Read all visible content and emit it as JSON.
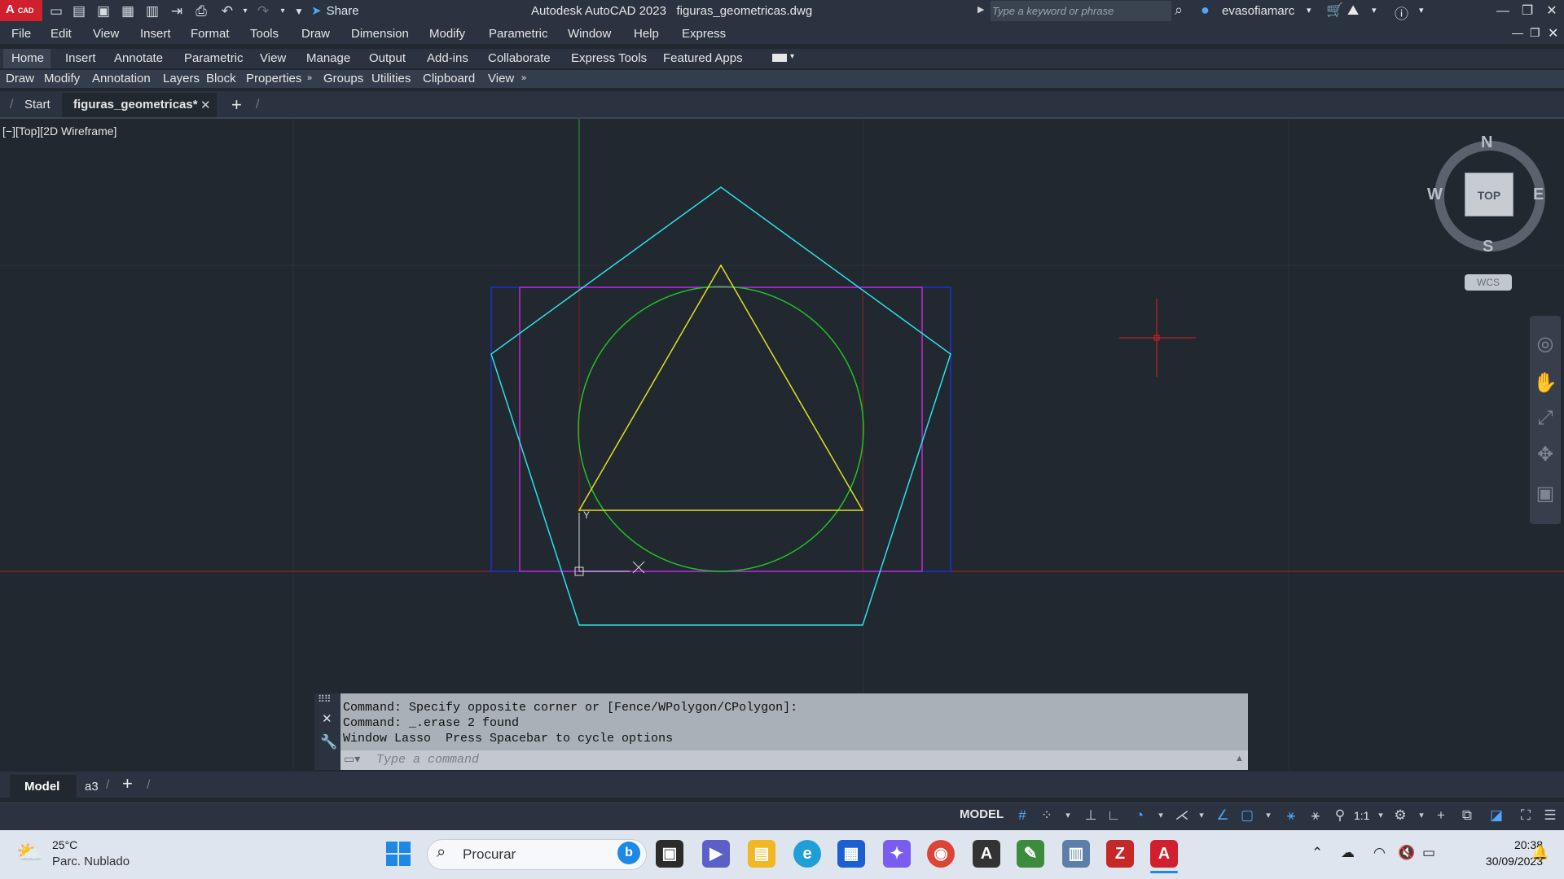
{
  "app": {
    "logo_text": "A",
    "logo_sub": "CAD",
    "title": "Autodesk AutoCAD 2023   figuras_geometricas.dwg",
    "share_label": "Share",
    "search_placeholder": "Type a keyword or phrase",
    "user_name": "evasofiamarc"
  },
  "menu": [
    "File",
    "Edit",
    "View",
    "Insert",
    "Format",
    "Tools",
    "Draw",
    "Dimension",
    "Modify",
    "Parametric",
    "Window",
    "Help",
    "Express"
  ],
  "ribbon_tabs": [
    "Home",
    "Insert",
    "Annotate",
    "Parametric",
    "View",
    "Manage",
    "Output",
    "Add-ins",
    "Collaborate",
    "Express Tools",
    "Featured Apps"
  ],
  "ribbon_panels": [
    "Draw",
    "Modify",
    "Annotation",
    "Layers",
    "Block",
    "Properties",
    "Groups",
    "Utilities",
    "Clipboard",
    "View"
  ],
  "file_tabs": {
    "start": "Start",
    "active": "figuras_geometricas*"
  },
  "viewport_label": "[−][Top][2D Wireframe]",
  "viewcube": {
    "north": "N",
    "south": "S",
    "east": "E",
    "west": "W",
    "face": "TOP",
    "wcs": "WCS"
  },
  "command_line": {
    "history": [
      "Command: Specify opposite corner or [Fence/WPolygon/CPolygon]:",
      "Command: _.erase 2 found",
      "Window Lasso  Press Spacebar to cycle options"
    ],
    "placeholder": "Type a command"
  },
  "layout_tabs": [
    "Model",
    "a3"
  ],
  "status": {
    "model": "MODEL",
    "scale": "1:1"
  },
  "taskbar": {
    "temperature": "25°C",
    "weather": "Parc. Nublado",
    "search": "Procurar",
    "time": "20:38",
    "date": "30/09/2023"
  },
  "colors": {
    "pentagon": "#2ee0e6",
    "rectangle_outer": "#1d2fd6",
    "rectangle_magenta": "#c424d6",
    "circle": "#22c122",
    "triangle": "#e0e01f",
    "axis_y": "#2aa52a",
    "axis_x": "#a12626",
    "guide_red": "#8b1c1c",
    "cursor": "#e02020"
  }
}
